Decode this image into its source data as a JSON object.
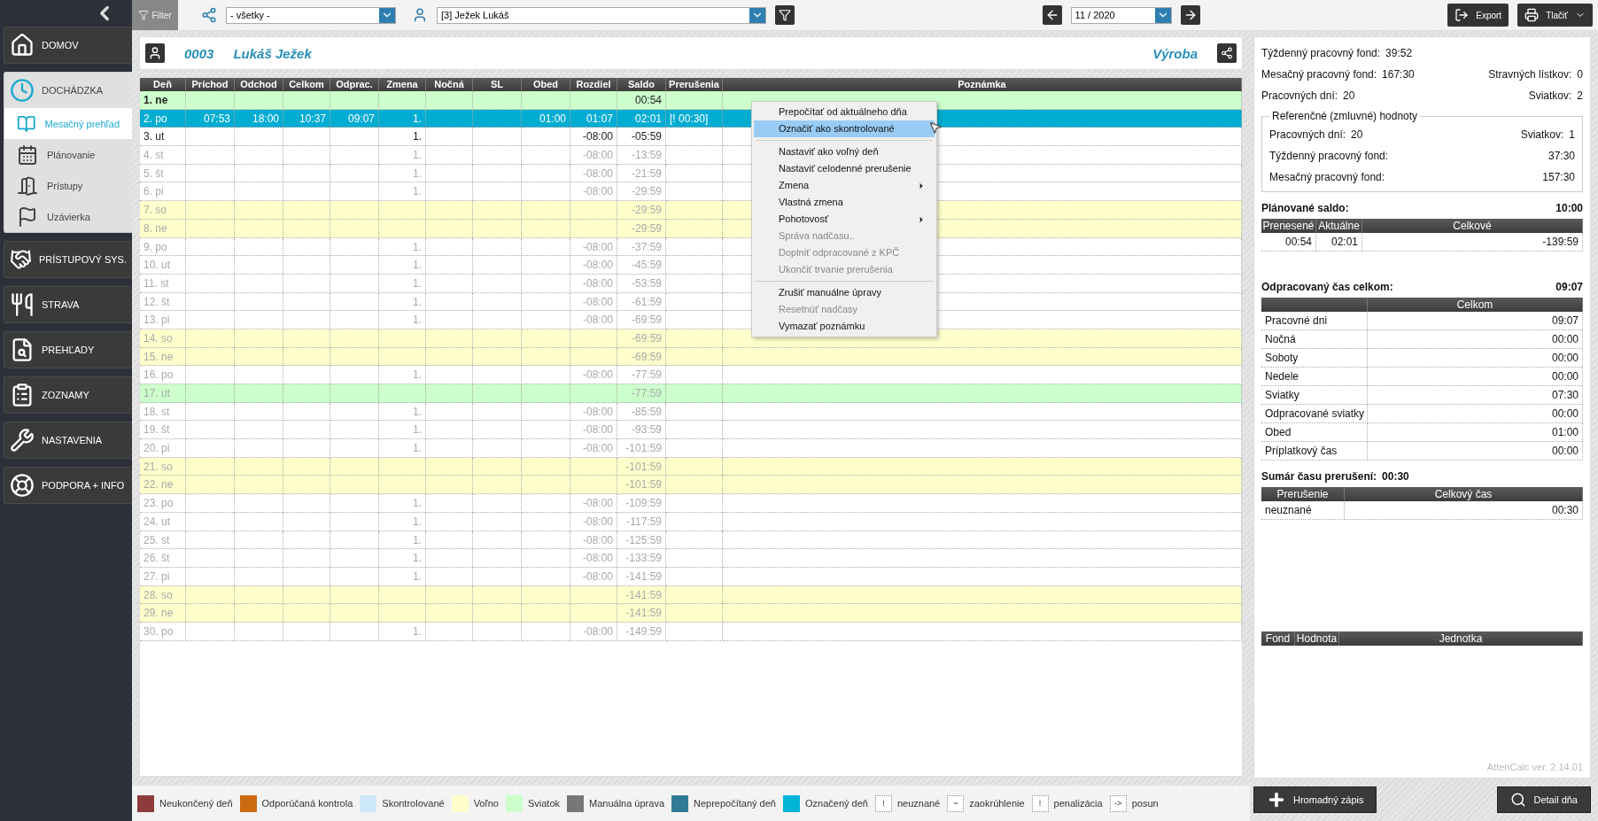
{
  "sidebar": {
    "items": [
      {
        "label": "DOMOV",
        "expanded": false
      },
      {
        "label": "DOCHÁDZKA",
        "expanded": true,
        "children": [
          {
            "label": "Mesačný prehľad",
            "selected": true
          },
          {
            "label": "Plánovanie",
            "selected": false
          },
          {
            "label": "Prístupy",
            "selected": false
          },
          {
            "label": "Uzávierka",
            "selected": false
          }
        ]
      },
      {
        "label": "PRÍSTUPOVÝ SYS.",
        "expanded": false
      },
      {
        "label": "STRAVA",
        "expanded": false
      },
      {
        "label": "PREHĽADY",
        "expanded": false
      },
      {
        "label": "ZOZNAMY",
        "expanded": false
      },
      {
        "label": "NASTAVENIA",
        "expanded": false
      },
      {
        "label": "PODPORA + INFO",
        "expanded": false
      }
    ]
  },
  "toolbar": {
    "filter": "Filter",
    "department": "- všetky -",
    "employee": "[3] Ježek Lukáš",
    "month": "11 / 2020",
    "export": "Export",
    "print": "Tlačiť"
  },
  "employee": {
    "number": "0003",
    "name": "Lukáš Ježek",
    "department": "Výroba"
  },
  "table": {
    "columns": [
      "Deň",
      "Príchod",
      "Odchod",
      "Celkom",
      "Odprac.",
      "Zmena",
      "Nočná",
      "SL",
      "Obed",
      "Rozdiel",
      "Saldo",
      "Prerušenia",
      "Poznámka"
    ],
    "rows": [
      {
        "day": "1. ne",
        "kind": "holiday",
        "dimmed": false,
        "selected": false,
        "saldo": "00:54"
      },
      {
        "day": "2. po",
        "kind": "workday",
        "dimmed": false,
        "selected": true,
        "arrival": "07:53",
        "departure": "18:00",
        "total": "10:37",
        "worked": "09:07",
        "shift": "1.",
        "lunch": "01:00",
        "diff": "01:07",
        "saldo": "02:01",
        "breaks": "[! 00:30]"
      },
      {
        "day": "3. ut",
        "kind": "workday",
        "dimmed": false,
        "selected": false,
        "shift": "1.",
        "diff": "-08:00",
        "saldo": "-05:59"
      },
      {
        "day": "4. st",
        "kind": "workday",
        "dimmed": true,
        "selected": false,
        "shift": "1.",
        "diff": "-08:00",
        "saldo": "-13:59"
      },
      {
        "day": "5. št",
        "kind": "workday",
        "dimmed": true,
        "selected": false,
        "shift": "1.",
        "diff": "-08:00",
        "saldo": "-21:59"
      },
      {
        "day": "6. pi",
        "kind": "workday",
        "dimmed": true,
        "selected": false,
        "shift": "1.",
        "diff": "-08:00",
        "saldo": "-29:59"
      },
      {
        "day": "7. so",
        "kind": "weekend",
        "dimmed": true,
        "selected": false,
        "saldo": "-29:59"
      },
      {
        "day": "8. ne",
        "kind": "weekend",
        "dimmed": true,
        "selected": false,
        "saldo": "-29:59"
      },
      {
        "day": "9. po",
        "kind": "workday",
        "dimmed": true,
        "selected": false,
        "shift": "1.",
        "diff": "-08:00",
        "saldo": "-37:59"
      },
      {
        "day": "10. ut",
        "kind": "workday",
        "dimmed": true,
        "selected": false,
        "shift": "1.",
        "diff": "-08:00",
        "saldo": "-45:59"
      },
      {
        "day": "11. st",
        "kind": "workday",
        "dimmed": true,
        "selected": false,
        "shift": "1.",
        "diff": "-08:00",
        "saldo": "-53:59"
      },
      {
        "day": "12. št",
        "kind": "workday",
        "dimmed": true,
        "selected": false,
        "shift": "1.",
        "diff": "-08:00",
        "saldo": "-61:59"
      },
      {
        "day": "13. pi",
        "kind": "workday",
        "dimmed": true,
        "selected": false,
        "shift": "1.",
        "diff": "-08:00",
        "saldo": "-69:59"
      },
      {
        "day": "14. so",
        "kind": "weekend",
        "dimmed": true,
        "selected": false,
        "saldo": "-69:59"
      },
      {
        "day": "15. ne",
        "kind": "weekend",
        "dimmed": true,
        "selected": false,
        "saldo": "-69:59"
      },
      {
        "day": "16. po",
        "kind": "workday",
        "dimmed": true,
        "selected": false,
        "shift": "1.",
        "diff": "-08:00",
        "saldo": "-77:59"
      },
      {
        "day": "17. ut",
        "kind": "holiday",
        "dimmed": true,
        "selected": false,
        "saldo": "-77:59"
      },
      {
        "day": "18. st",
        "kind": "workday",
        "dimmed": true,
        "selected": false,
        "shift": "1.",
        "diff": "-08:00",
        "saldo": "-85:59"
      },
      {
        "day": "19. št",
        "kind": "workday",
        "dimmed": true,
        "selected": false,
        "shift": "1.",
        "diff": "-08:00",
        "saldo": "-93:59"
      },
      {
        "day": "20. pi",
        "kind": "workday",
        "dimmed": true,
        "selected": false,
        "shift": "1.",
        "diff": "-08:00",
        "saldo": "-101:59"
      },
      {
        "day": "21. so",
        "kind": "weekend",
        "dimmed": true,
        "selected": false,
        "saldo": "-101:59"
      },
      {
        "day": "22. ne",
        "kind": "weekend",
        "dimmed": true,
        "selected": false,
        "saldo": "-101:59"
      },
      {
        "day": "23. po",
        "kind": "workday",
        "dimmed": true,
        "selected": false,
        "shift": "1.",
        "diff": "-08:00",
        "saldo": "-109:59"
      },
      {
        "day": "24. ut",
        "kind": "workday",
        "dimmed": true,
        "selected": false,
        "shift": "1.",
        "diff": "-08:00",
        "saldo": "-117:59"
      },
      {
        "day": "25. st",
        "kind": "workday",
        "dimmed": true,
        "selected": false,
        "shift": "1.",
        "diff": "-08:00",
        "saldo": "-125:59"
      },
      {
        "day": "26. št",
        "kind": "workday",
        "dimmed": true,
        "selected": false,
        "shift": "1.",
        "diff": "-08:00",
        "saldo": "-133:59"
      },
      {
        "day": "27. pi",
        "kind": "workday",
        "dimmed": true,
        "selected": false,
        "shift": "1.",
        "diff": "-08:00",
        "saldo": "-141:59"
      },
      {
        "day": "28. so",
        "kind": "weekend",
        "dimmed": true,
        "selected": false,
        "saldo": "-141:59"
      },
      {
        "day": "29. ne",
        "kind": "weekend",
        "dimmed": true,
        "selected": false,
        "saldo": "-141:59"
      },
      {
        "day": "30. po",
        "kind": "workday",
        "dimmed": true,
        "selected": false,
        "shift": "1.",
        "diff": "-08:00",
        "saldo": "-149:59"
      }
    ]
  },
  "context_menu": {
    "groups": [
      [
        {
          "label": "Prepočítať od aktuálneho dňa",
          "disabled": false,
          "selected": false,
          "submenu": false
        },
        {
          "label": "Označiť ako skontrolované",
          "disabled": false,
          "selected": true,
          "submenu": false
        }
      ],
      [
        {
          "label": "Nastaviť ako voľný deň",
          "disabled": false,
          "selected": false,
          "submenu": false
        },
        {
          "label": "Nastaviť celodenné prerušenie",
          "disabled": false,
          "selected": false,
          "submenu": false
        },
        {
          "label": "Zmena",
          "disabled": false,
          "selected": false,
          "submenu": true
        },
        {
          "label": "Vlastná zmena",
          "disabled": false,
          "selected": false,
          "submenu": false
        },
        {
          "label": "Pohotovosť",
          "disabled": false,
          "selected": false,
          "submenu": true
        },
        {
          "label": "Správa nadčasu..",
          "disabled": true,
          "selected": false,
          "submenu": false
        },
        {
          "label": "Doplniť odpracované z KPČ",
          "disabled": true,
          "selected": false,
          "submenu": false
        },
        {
          "label": "Ukončiť trvanie prerušenia",
          "disabled": true,
          "selected": false,
          "submenu": false
        }
      ],
      [
        {
          "label": "Zrušiť manuálne úpravy",
          "disabled": false,
          "selected": false,
          "submenu": false
        },
        {
          "label": "Resetnúť nadčasy",
          "disabled": true,
          "selected": false,
          "submenu": false
        },
        {
          "label": "Vymazať poznámku",
          "disabled": false,
          "selected": false,
          "submenu": false
        }
      ]
    ]
  },
  "legend": [
    {
      "kind": "swatch",
      "color": "#8e3b3b",
      "label": "Neukončený deň"
    },
    {
      "kind": "swatch",
      "color": "#cc6a10",
      "label": "Odporúčaná kontrola"
    },
    {
      "kind": "swatch",
      "color": "#cce8fa",
      "label": "Skontrolované"
    },
    {
      "kind": "swatch",
      "color": "#ffffcc",
      "label": "Voľno"
    },
    {
      "kind": "swatch",
      "color": "#ccffcc",
      "label": "Sviatok"
    },
    {
      "kind": "swatch",
      "color": "#777777",
      "label": "Manuálna úprava"
    },
    {
      "kind": "swatch",
      "color": "#2f7b96",
      "label": "Neprepočítaný deň"
    },
    {
      "kind": "swatch",
      "color": "#00b4d8",
      "label": "Označený deň"
    },
    {
      "kind": "symbol",
      "symbol": "!",
      "label": "neuznané"
    },
    {
      "kind": "symbol",
      "symbol": "~",
      "label": "zaokrúhlenie"
    },
    {
      "kind": "symbol",
      "symbol": "!",
      "label": "penalizácia"
    },
    {
      "kind": "symbol",
      "symbol": "->",
      "label": "posun"
    }
  ],
  "summary": {
    "lines": [
      [
        {
          "label": "Týždenný pracovný fond:",
          "value": "39:52"
        }
      ],
      [
        {
          "label": "Mesačný pracovný fond:",
          "value": "167:30"
        },
        {
          "label": "Stravných lístkov:",
          "value": "0"
        }
      ],
      [
        {
          "label": "Pracovných dní:",
          "value": "20"
        },
        {
          "label": "Sviatkov:",
          "value": "2"
        }
      ]
    ],
    "reference": {
      "title": "Referenčné (zmluvné) hodnoty",
      "lines": [
        [
          {
            "label": "Pracovných dní:",
            "value": "20"
          },
          {
            "label": "Sviatkov:",
            "value": "1"
          }
        ],
        [
          {
            "label": "Týždenný pracovný fond:",
            "value": "37:30"
          }
        ],
        [
          {
            "label": "Mesačný pracovný fond:",
            "value": "157:30"
          }
        ]
      ]
    },
    "planned": {
      "label": "Plánované saldo:",
      "value": "10:00",
      "columns": [
        "Prenesené",
        "Aktuálne",
        "Celkové"
      ],
      "row": [
        "00:54",
        "02:01",
        "-139:59"
      ]
    },
    "worked": {
      "label": "Odpracovaný čas celkom:",
      "value": "09:07",
      "column": "Celkom",
      "rows": [
        {
          "label": "Pracovné dni",
          "value": "09:07"
        },
        {
          "label": "Nočná",
          "value": "00:00"
        },
        {
          "label": "Soboty",
          "value": "00:00"
        },
        {
          "label": "Nedele",
          "value": "00:00"
        },
        {
          "label": "Sviatky",
          "value": "07:30"
        },
        {
          "label": "Odpracované sviatky",
          "value": "00:00"
        },
        {
          "label": "Obed",
          "value": "01:00"
        },
        {
          "label": "Príplatkový čas",
          "value": "00:00"
        }
      ]
    },
    "breaks": {
      "label": "Sumár času prerušení:",
      "value": "00:30",
      "columns": [
        "Prerušenie",
        "Celkový čas"
      ],
      "rows": [
        {
          "label": "neuznané",
          "value": "00:30"
        }
      ]
    },
    "funds": {
      "columns": [
        "Fond",
        "Hodnota",
        "Jednotka"
      ]
    },
    "version": "AttenCalc ver. 2.14.01"
  },
  "actions": {
    "bulk": "Hromadný zápis",
    "detail": "Detail dňa"
  }
}
